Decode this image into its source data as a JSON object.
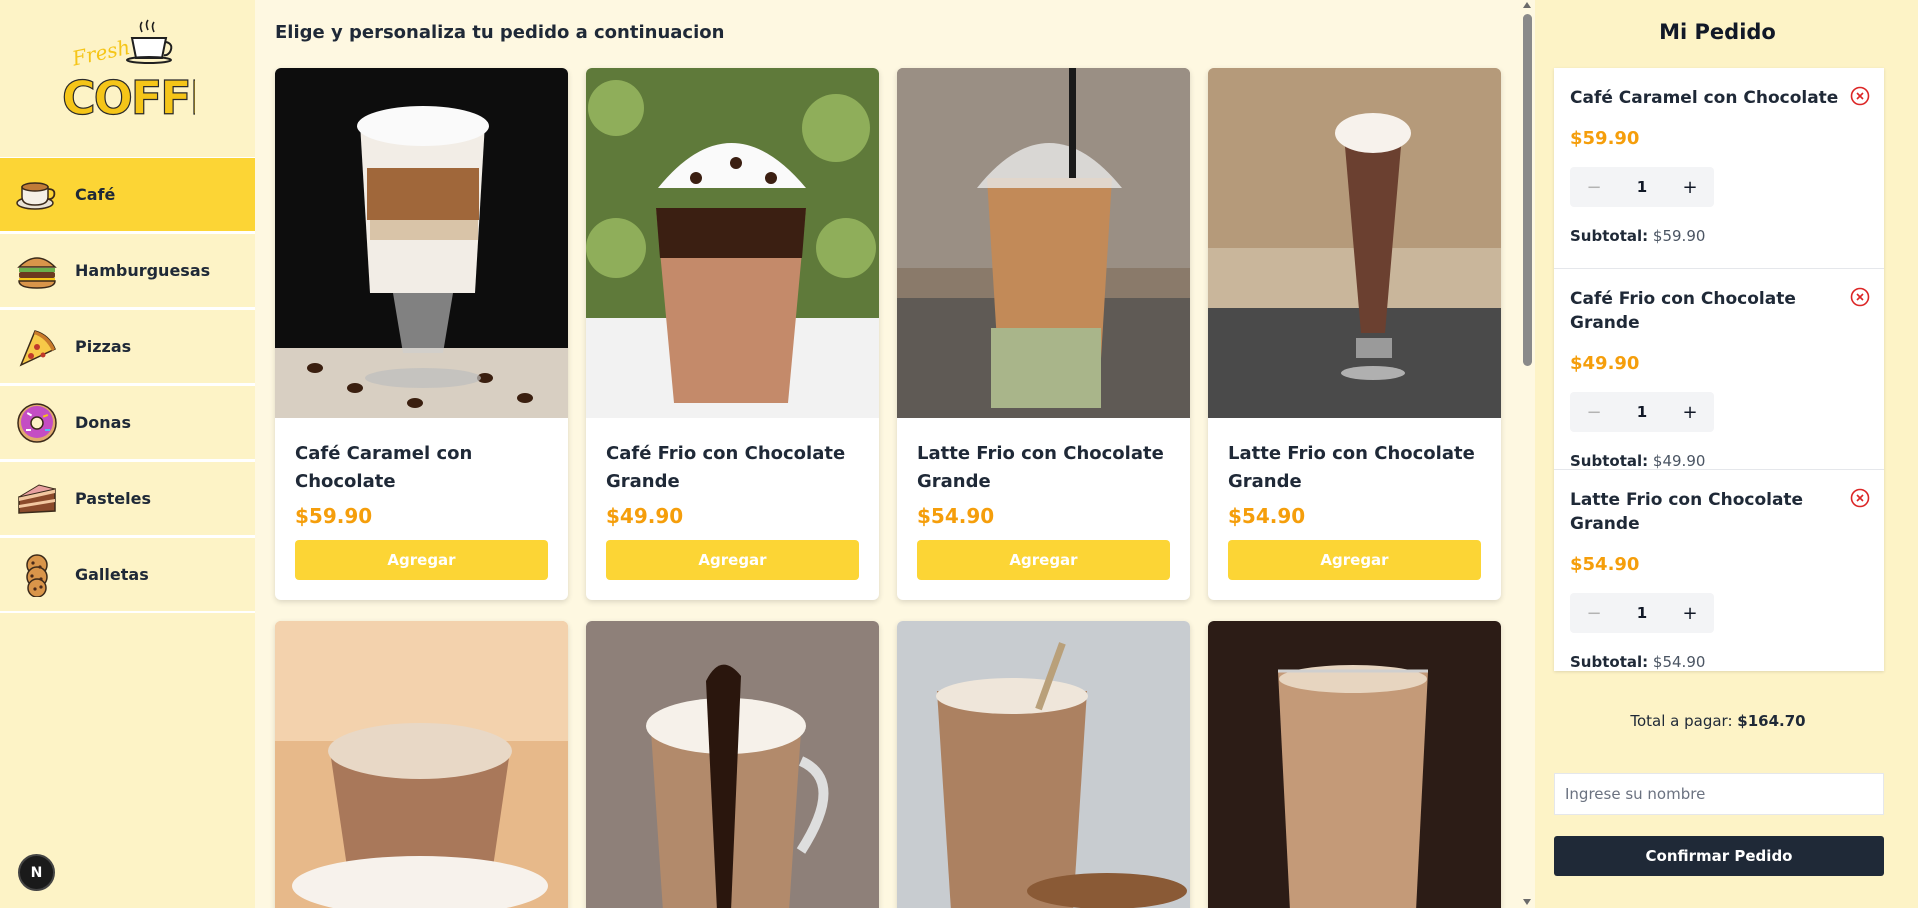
{
  "brand": {
    "script": "Fresh",
    "word": "COFFEE"
  },
  "categories": [
    {
      "label": "Café",
      "icon": "coffee-cup-icon",
      "active": true
    },
    {
      "label": "Hamburguesas",
      "icon": "burger-icon",
      "active": false
    },
    {
      "label": "Pizzas",
      "icon": "pizza-slice-icon",
      "active": false
    },
    {
      "label": "Donas",
      "icon": "donut-icon",
      "active": false
    },
    {
      "label": "Pasteles",
      "icon": "cake-slice-icon",
      "active": false
    },
    {
      "label": "Galletas",
      "icon": "cookies-icon",
      "active": false
    }
  ],
  "main": {
    "heading": "Elige y personaliza tu pedido a continuacion",
    "add_label": "Agregar",
    "products": [
      {
        "name": "Café Caramel con Chocolate",
        "price": "$59.90"
      },
      {
        "name": "Café Frio con Chocolate Grande",
        "price": "$49.90"
      },
      {
        "name": "Latte Frio con Chocolate Grande",
        "price": "$54.90"
      },
      {
        "name": "Latte Frio con Chocolate Grande",
        "price": "$54.90"
      }
    ]
  },
  "order": {
    "title": "Mi Pedido",
    "subtotal_label": "Subtotal:",
    "items": [
      {
        "name": "Café Caramel con Chocolate",
        "price": "$59.90",
        "qty": "1",
        "subtotal": "$59.90"
      },
      {
        "name": "Café Frio con Chocolate Grande",
        "price": "$49.90",
        "qty": "1",
        "subtotal": "$49.90"
      },
      {
        "name": "Latte Frio con Chocolate Grande",
        "price": "$54.90",
        "qty": "1",
        "subtotal": "$54.90"
      }
    ],
    "total_label": "Total a pagar:",
    "total_value": "$164.70",
    "name_placeholder": "Ingrese su nombre",
    "confirm_label": "Confirmar Pedido"
  },
  "badge": {
    "letter": "N"
  },
  "colors": {
    "accent": "#fcd535",
    "price": "#f59e0b",
    "dark": "#1f2937",
    "sidebar_bg": "#fdf3c6",
    "page_bg": "#fef8e1",
    "remove": "#dc2626"
  }
}
